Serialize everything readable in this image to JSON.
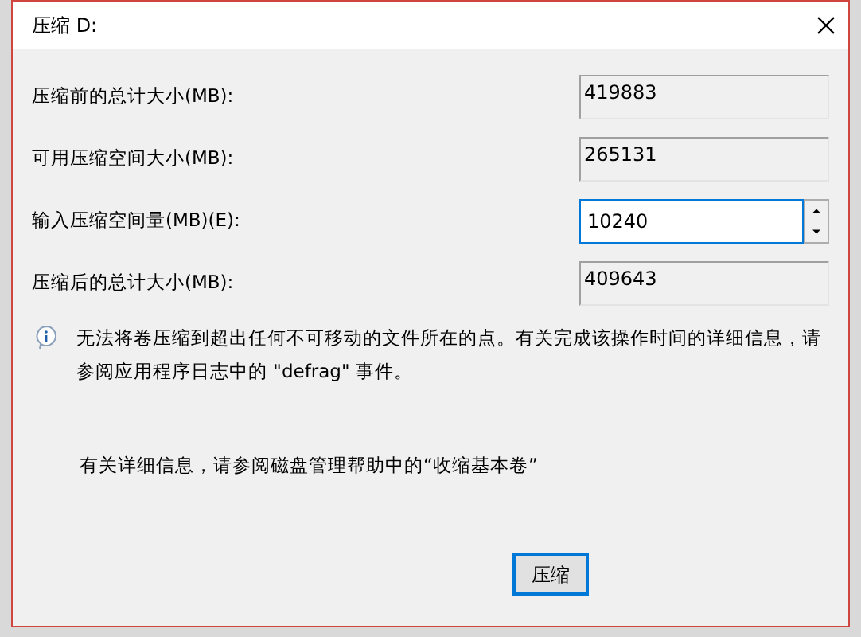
{
  "window": {
    "title": "压缩 D:"
  },
  "fields": [
    {
      "label": "压缩前的总计大小(MB):",
      "value": "419883",
      "kind": "readonly"
    },
    {
      "label": "可用压缩空间大小(MB):",
      "value": "265131",
      "kind": "readonly"
    },
    {
      "label": "输入压缩空间量(MB)(E):",
      "value": "10240",
      "kind": "spin"
    },
    {
      "label": "压缩后的总计大小(MB):",
      "value": "409643",
      "kind": "readonly"
    }
  ],
  "info": "无法将卷压缩到超出任何不可移动的文件所在的点。有关完成该操作时间的详细信息，请参阅应用程序日志中的 \"defrag\" 事件。",
  "help": "有关详细信息，请参阅磁盘管理帮助中的“收缩基本卷”",
  "buttons": [
    {
      "label": "压缩",
      "default": true
    }
  ]
}
